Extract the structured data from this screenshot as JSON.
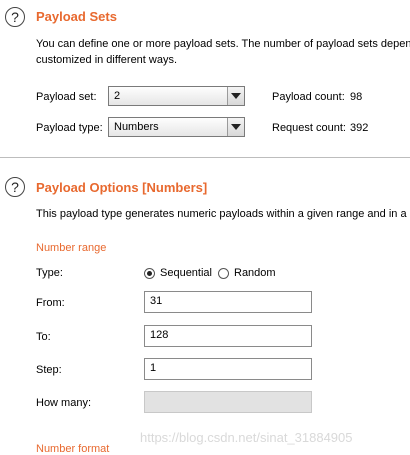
{
  "payload_sets": {
    "title": "Payload Sets",
    "description_line1": "You can define one or more payload sets. The number of payload sets depen",
    "description_line2": "customized in different ways.",
    "payload_set_label": "Payload set:",
    "payload_set_value": "2",
    "payload_type_label": "Payload type:",
    "payload_type_value": "Numbers",
    "payload_count_label": "Payload count:",
    "payload_count_value": "98",
    "request_count_label": "Request count:",
    "request_count_value": "392"
  },
  "payload_options": {
    "title": "Payload Options [Numbers]",
    "description": "This payload type generates numeric payloads within a given range and in a s",
    "number_range_heading": "Number range",
    "type_label": "Type:",
    "sequential_label": "Sequential",
    "random_label": "Random",
    "selected_type": "Sequential",
    "from_label": "From:",
    "from_value": "31",
    "to_label": "To:",
    "to_value": "128",
    "step_label": "Step:",
    "step_value": "1",
    "how_many_label": "How many:",
    "how_many_value": "",
    "number_format_heading": "Number format"
  },
  "help_icon_glyph": "?",
  "watermark": "https://blog.csdn.net/sinat_31884905",
  "colors": {
    "accent": "#e8692f",
    "divider": "#bdbdbd",
    "disabled_field": "#e2e2e2"
  }
}
